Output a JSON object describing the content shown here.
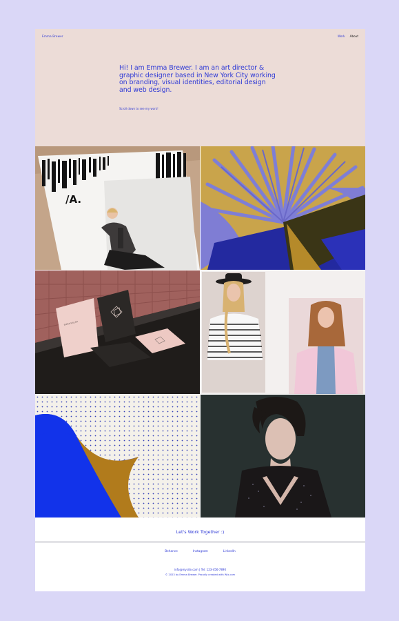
{
  "header": {
    "brand": "Emma Brewer",
    "nav": {
      "work": "Work",
      "about": "About"
    }
  },
  "hero": {
    "intro": "Hi! I am Emma Brewer. I am an art director & graphic designer based in New York City working on branding, visual identities, editorial design and web design.",
    "scroll_note": "Scroll down to see my work!"
  },
  "portfolio": {
    "items": [
      {
        "name": "branding-editorial",
        "icon": "magazine-photo"
      },
      {
        "name": "palm-illustration",
        "icon": "palm-leaf-art"
      },
      {
        "name": "business-cards",
        "icon": "stationery-mockup"
      },
      {
        "name": "fashion-lookbook",
        "icon": "fashion-photos"
      },
      {
        "name": "dotted-paper",
        "icon": "paper-curl"
      },
      {
        "name": "portrait",
        "icon": "portrait-photo"
      }
    ]
  },
  "card_text": {
    "name": "EMMA MILLER"
  },
  "footer": {
    "cta": "Let's Work Together :)",
    "social": {
      "behance": "Behance",
      "instagram": "Instagram",
      "linkedin": "LinkedIn"
    },
    "contact": "info@mysite.com   |   Tel: 123-456-7890",
    "copyright": "© 2023 by Emma Brewer. Proudly created with Wix.com"
  },
  "colors": {
    "background": "#dad7f7",
    "hero": "#ecdcd7",
    "accent": "#2f3ad6"
  }
}
